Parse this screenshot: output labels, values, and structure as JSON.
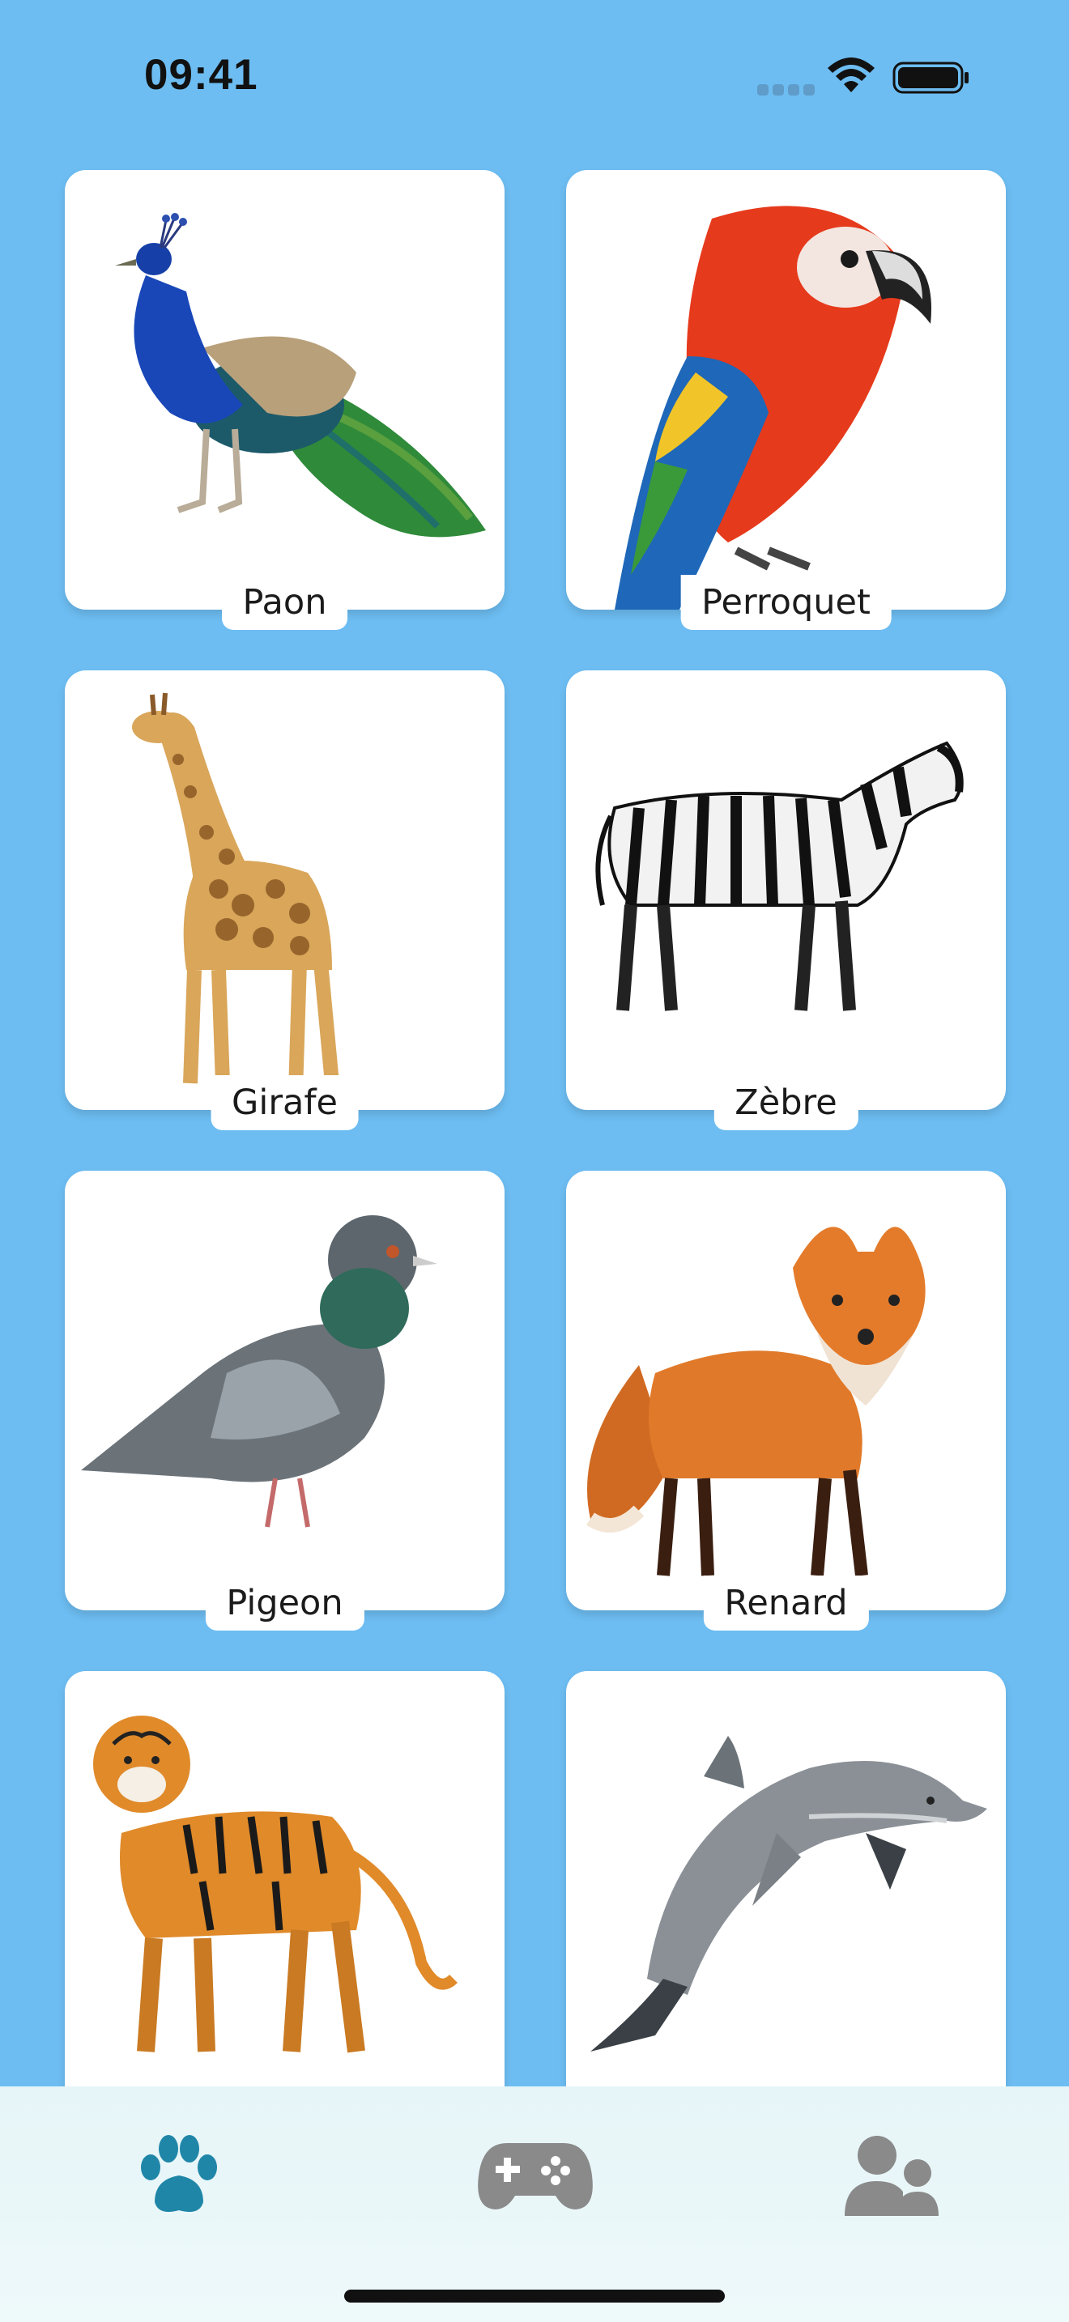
{
  "status_bar": {
    "time": "09:41"
  },
  "animals": [
    {
      "label": "Paon",
      "icon": "peacock-image"
    },
    {
      "label": "Perroquet",
      "icon": "parrot-image"
    },
    {
      "label": "Girafe",
      "icon": "giraffe-image"
    },
    {
      "label": "Zèbre",
      "icon": "zebra-image"
    },
    {
      "label": "Pigeon",
      "icon": "pigeon-image"
    },
    {
      "label": "Renard",
      "icon": "fox-image"
    },
    {
      "label": "",
      "icon": "tiger-image"
    },
    {
      "label": "",
      "icon": "dolphin-image"
    }
  ],
  "tab_bar": {
    "tabs": [
      {
        "icon": "paw-icon",
        "active": true
      },
      {
        "icon": "gamepad-icon",
        "active": false
      },
      {
        "icon": "users-icon",
        "active": false
      }
    ]
  },
  "colors": {
    "background": "#6dbdf2",
    "active_tab": "#1f86a8",
    "inactive_tab": "#8a8a8a"
  }
}
